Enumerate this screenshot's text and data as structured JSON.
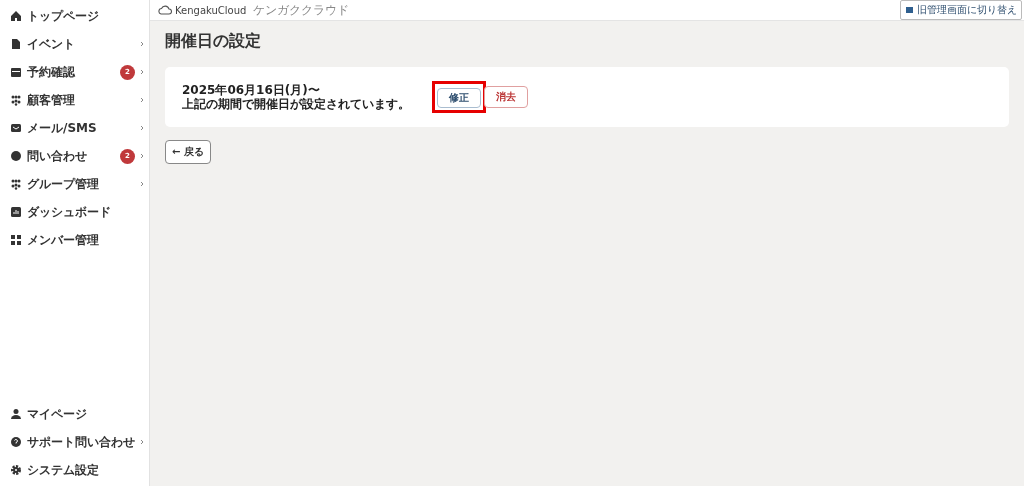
{
  "sidebar": {
    "items": [
      {
        "label": "トップページ",
        "chevron": false
      },
      {
        "label": "イベント",
        "chevron": true
      },
      {
        "label": "予約確認",
        "chevron": true,
        "badge": "2"
      },
      {
        "label": "顧客管理",
        "chevron": true
      },
      {
        "label": "メール/SMS",
        "chevron": true
      },
      {
        "label": "問い合わせ",
        "chevron": true,
        "badge": "2"
      },
      {
        "label": "グループ管理",
        "chevron": true
      },
      {
        "label": "ダッシュボード",
        "chevron": false
      },
      {
        "label": "メンバー管理",
        "chevron": false
      }
    ],
    "bottom_items": [
      {
        "label": "マイページ",
        "chevron": false
      },
      {
        "label": "サポート問い合わせ",
        "chevron": true
      },
      {
        "label": "システム設定",
        "chevron": false
      }
    ]
  },
  "header": {
    "logo": "KengakuCloud",
    "logo_sub": "ケンガククラウド",
    "switch_button": "旧管理画面に切り替え"
  },
  "page_title": "開催日の設定",
  "card": {
    "date": "2025年06月16日(月)〜",
    "message": "上記の期間で開催日が設定されています。",
    "edit_button": "修正",
    "edit_highlighted": true,
    "delete_button": "消去"
  },
  "back_button": "← 戻る"
}
